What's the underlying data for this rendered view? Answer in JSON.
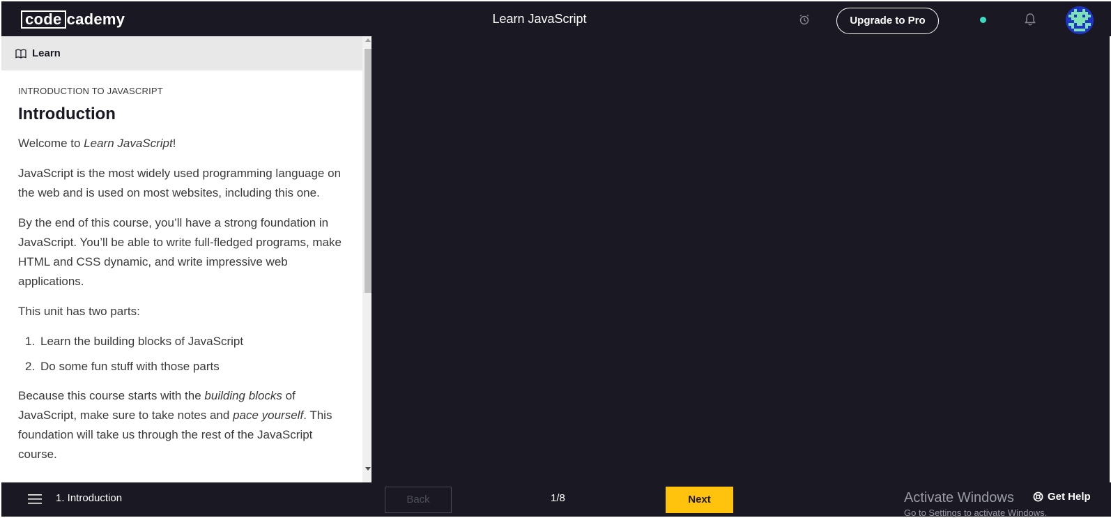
{
  "header": {
    "logo_code": "code",
    "logo_rest": "cademy",
    "title": "Learn JavaScript",
    "upgrade_label": "Upgrade to Pro",
    "icons": [
      "alarm-icon",
      "status-dot",
      "bell-icon",
      "avatar"
    ]
  },
  "panel": {
    "tab_label": "Learn",
    "eyebrow": "INTRODUCTION TO JAVASCRIPT",
    "title": "Introduction",
    "welcome_prefix": "Welcome to ",
    "welcome_em": "Learn JavaScript",
    "welcome_suffix": "!",
    "para1": "JavaScript is the most widely used programming language on the web and is used on most websites, including this one.",
    "para2": "By the end of this course, you’ll have a strong foundation in JavaScript. You’ll be able to write full-fledged programs, make HTML and CSS dynamic, and write impressive web applications.",
    "para3": "This unit has two parts:",
    "list": [
      {
        "num": "1.",
        "text": "Learn the building blocks of JavaScript"
      },
      {
        "num": "2.",
        "text": "Do some fun stuff with those parts"
      }
    ],
    "para4_a": "Because this course starts with the ",
    "para4_em1": "building blocks",
    "para4_b": " of JavaScript, make sure to take notes and ",
    "para4_em2": "pace yourself",
    "para4_c": ". This foundation will take us through the rest of the JavaScript course."
  },
  "footer": {
    "crumb": "1. Introduction",
    "back_label": "Back",
    "progress": "1/8",
    "next_label": "Next",
    "watermark_title": "Activate Windows",
    "watermark_sub": "Go to Settings to activate Windows.",
    "help_label": "Get Help"
  },
  "colors": {
    "dark_bg": "#191823",
    "accent_yellow": "#ffc20d",
    "status_teal": "#3ddbc4",
    "avatar_blue": "#1f33c7"
  }
}
